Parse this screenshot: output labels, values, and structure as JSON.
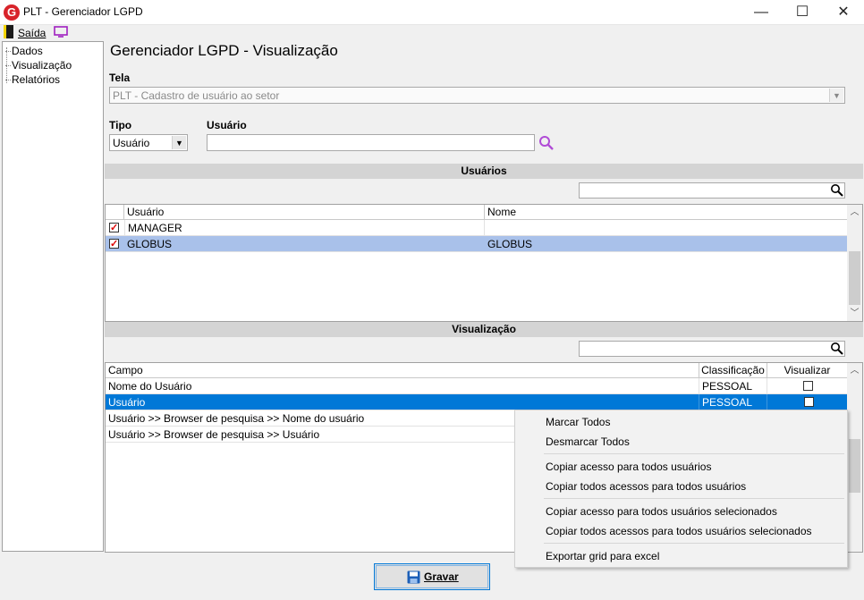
{
  "window": {
    "title": "PLT - Gerenciador LGPD",
    "minimize": "—",
    "maximize": "☐",
    "close": "✕",
    "logo": "G"
  },
  "menu": {
    "exit_label": "Saída"
  },
  "tree": {
    "items": [
      "Dados",
      "Visualização",
      "Relatórios"
    ]
  },
  "page": {
    "title": "Gerenciador LGPD - Visualização"
  },
  "tela": {
    "label": "Tela",
    "value": "PLT - Cadastro de usuário ao setor"
  },
  "tipo": {
    "label": "Tipo",
    "value": "Usuário"
  },
  "usuario": {
    "label": "Usuário",
    "value": ""
  },
  "usuarios_section": {
    "title": "Usuários",
    "columns": [
      "Usuário",
      "Nome"
    ],
    "rows": [
      {
        "checked": true,
        "usuario": "MANAGER",
        "nome": ""
      },
      {
        "checked": true,
        "usuario": "GLOBUS",
        "nome": "GLOBUS"
      }
    ]
  },
  "visualizacao_section": {
    "title": "Visualização",
    "columns": [
      "Campo",
      "Classificação",
      "Visualizar"
    ],
    "rows": [
      {
        "campo": "Nome do Usuário",
        "classificacao": "PESSOAL",
        "visualizar": false
      },
      {
        "campo": "Usuário",
        "classificacao": "PESSOAL",
        "visualizar": false
      },
      {
        "campo": "Usuário >> Browser de pesquisa >> Nome do usuário",
        "classificacao": "",
        "visualizar": false
      },
      {
        "campo": "Usuário >> Browser de pesquisa >> Usuário",
        "classificacao": "",
        "visualizar": false
      }
    ]
  },
  "context_menu": {
    "items": [
      "Marcar Todos",
      "Desmarcar Todos",
      "Copiar acesso para todos usuários",
      "Copiar todos acessos para todos usuários",
      "Copiar acesso para todos usuários selecionados",
      "Copiar todos acessos para todos usuários selecionados",
      "Exportar grid para excel"
    ]
  },
  "buttons": {
    "save_label": "Gravar"
  },
  "colors": {
    "selected_row": "#0078d7",
    "highlight_row": "#a9c1ea",
    "logo": "#d8232a",
    "save_icon": "#1c5fb8"
  }
}
